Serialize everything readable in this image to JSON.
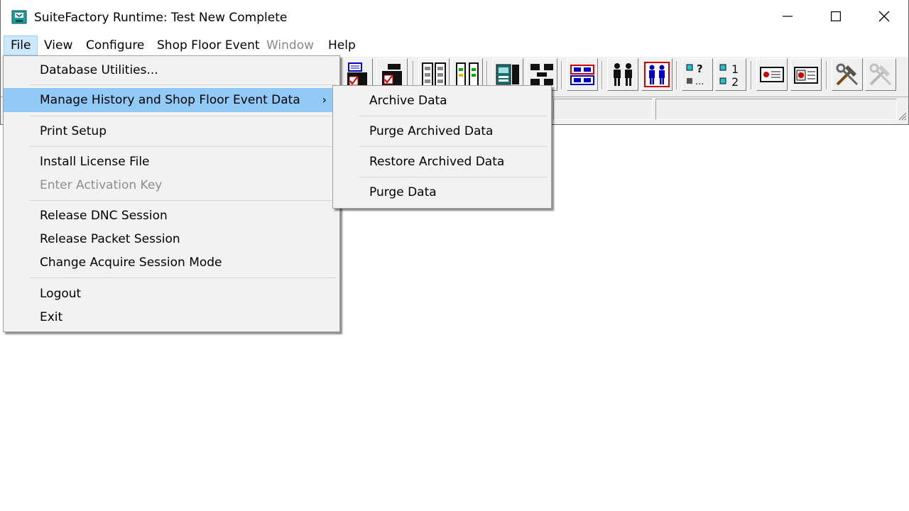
{
  "window": {
    "title": "SuiteFactory Runtime: Test New Complete",
    "icon": "suitefactory-app-icon",
    "controls": [
      "minimize-icon",
      "maximize-icon",
      "close-icon"
    ]
  },
  "menubar": {
    "items": [
      {
        "label": "File",
        "state": "active"
      },
      {
        "label": "View",
        "state": "normal"
      },
      {
        "label": "Configure",
        "state": "normal"
      },
      {
        "label": "Shop Floor Event",
        "state": "normal"
      },
      {
        "label": "Window",
        "state": "disabled"
      },
      {
        "label": "Help",
        "state": "normal"
      }
    ]
  },
  "toolbar": {
    "buttons": [
      {
        "icon": "machine-checklist-icon"
      },
      {
        "icon": "machine-checked-icon"
      },
      {
        "icon": "cabinet-pair-icon"
      },
      {
        "icon": "indicator-panel-icon"
      },
      {
        "icon": "server-rack-icon"
      },
      {
        "icon": "network-nodes-icon"
      },
      {
        "icon": "red-blue-panel-icon"
      },
      {
        "icon": "two-operators-icon"
      },
      {
        "icon": "operators-highlight-icon"
      },
      {
        "icon": "question-list-icon"
      },
      {
        "icon": "numbered-list-icon"
      },
      {
        "icon": "report-card-icon"
      },
      {
        "icon": "report-chart-icon"
      },
      {
        "icon": "tools-icon"
      },
      {
        "icon": "tools-disabled-icon"
      }
    ]
  },
  "file_menu": {
    "items": [
      {
        "label": "Database Utilities...",
        "state": "normal"
      },
      {
        "label": "Manage History and Shop Floor Event Data",
        "state": "highlighted",
        "submenu_glyph": "›"
      },
      {
        "label": "Print Setup",
        "state": "normal"
      },
      {
        "label": "Install License File",
        "state": "normal"
      },
      {
        "label": "Enter Activation Key",
        "state": "disabled"
      },
      {
        "label": "Release DNC Session",
        "state": "normal"
      },
      {
        "label": "Release Packet Session",
        "state": "normal"
      },
      {
        "label": "Change Acquire Session Mode",
        "state": "normal"
      },
      {
        "label": "Logout",
        "state": "normal"
      },
      {
        "label": "Exit",
        "state": "normal"
      }
    ]
  },
  "submenu": {
    "items": [
      {
        "label": "Archive Data"
      },
      {
        "label": "Purge Archived Data"
      },
      {
        "label": "Restore Archived Data"
      },
      {
        "label": "Purge Data"
      }
    ]
  },
  "colors": {
    "menu_highlight": "#91c9f7",
    "menubar_active": "#cce8ff",
    "disabled_text": "#8d8d8d"
  }
}
